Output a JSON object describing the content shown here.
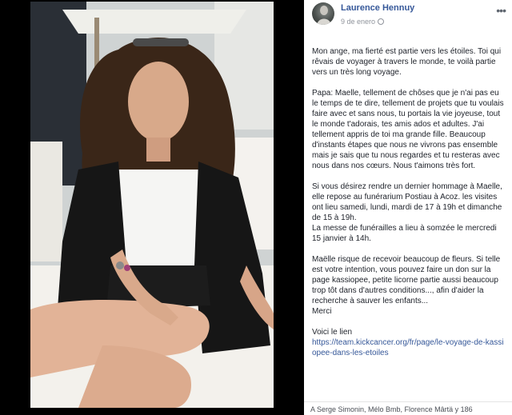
{
  "post": {
    "author": "Laurence Hennuy",
    "date": "9 de enero",
    "more_icon": "more-options-icon",
    "body": [
      "Mon ange, ma fierté est partie vers les étoiles. Toi qui rêvais de voyager à travers le monde, te voilà partie vers un très long voyage.",
      "Papa: Maelle, tellement de chôses que je n'ai pas eu le temps de te dire, tellement de projets que tu voulais faire avec et sans nous, tu portais la vie joyeuse, tout le monde t'adorais, tes amis ados et adultes. J'ai tellement appris de toi ma grande fille. Beaucoup d'instants étapes que nous ne vivrons pas ensemble mais je sais que tu nous regardes et tu resteras avec nous dans nos cœurs. Nous t'aimons très fort.",
      "Si vous désirez rendre un dernier hommage à Maelle, elle repose au funérarium Postiau à Acoz. les visites ont lieu samedi, lundi, mardi de 17 à 19h et dimanche de 15 à 19h.\nLa messe de funérailles a lieu à somzée le mercredi 15 janvier à 14h.",
      "Maëlle risque de recevoir beaucoup de fleurs. Si telle est votre intention, vous pouvez faire un don sur la page kassiopee, petite licorne partie aussi beaucoup trop tôt dans d'autres conditions..., afin d'aider la recherche à sauver les enfants...\nMerci"
    ],
    "link_intro": "Voici le lien",
    "link_url": "https://team.kickcancer.org/fr/page/le-voyage-de-kassiopee-dans-les-etoiles",
    "reactions": "A Serge Simonin, Mélo Bmb, Florence Mârtä y 186"
  }
}
